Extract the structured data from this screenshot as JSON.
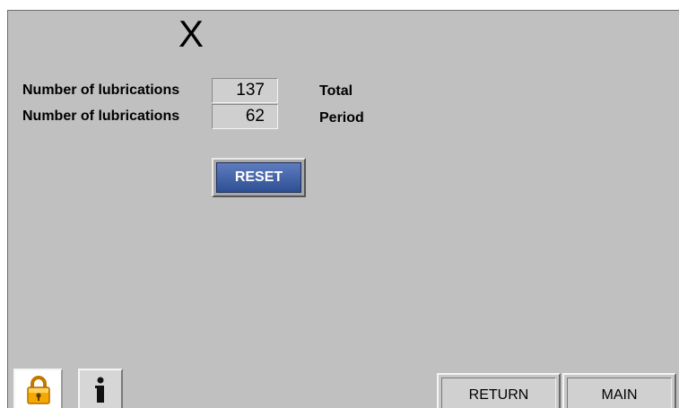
{
  "screen": {
    "title": "X"
  },
  "counters": [
    {
      "label": "Number of lubrications",
      "value": "137",
      "unit": "Total"
    },
    {
      "label": "Number of lubrications",
      "value": "62",
      "unit": "Period"
    }
  ],
  "buttons": {
    "reset_label": "RESET",
    "return_label": "RETURN",
    "main_label": "MAIN"
  },
  "icons": {
    "lock": "lock-icon",
    "info": "info-icon"
  },
  "colors": {
    "background": "#c0c0c0",
    "reset_button": "#3a5ba0",
    "lock_icon": "#f0a000"
  }
}
